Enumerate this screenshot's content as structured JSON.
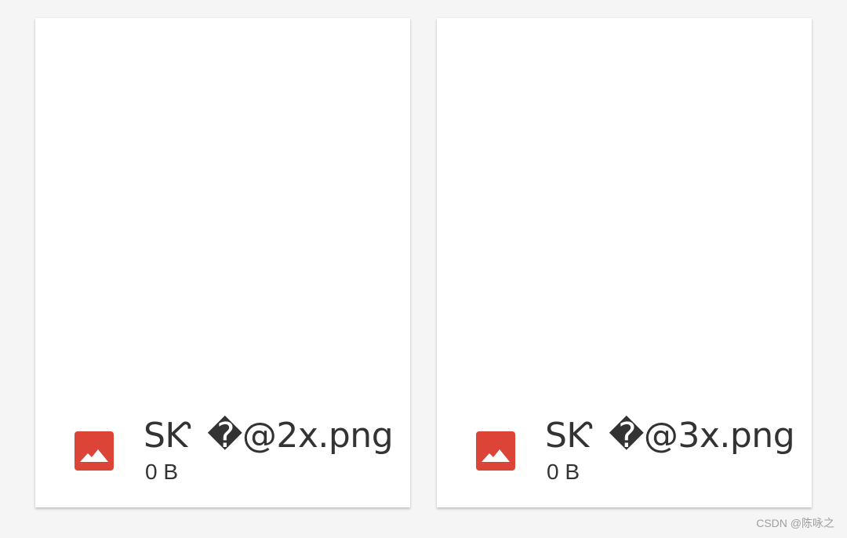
{
  "files": [
    {
      "name": "SƘ �@2x.png",
      "size": "0 B",
      "icon": "image-file-icon"
    },
    {
      "name": "SƘ �@3x.png",
      "size": "0 B",
      "icon": "image-file-icon"
    }
  ],
  "colors": {
    "page_background": "#f5f5f5",
    "card_background": "#ffffff",
    "icon_accent": "#db4437",
    "text": "#333333"
  },
  "watermark": "CSDN @陈咏之"
}
